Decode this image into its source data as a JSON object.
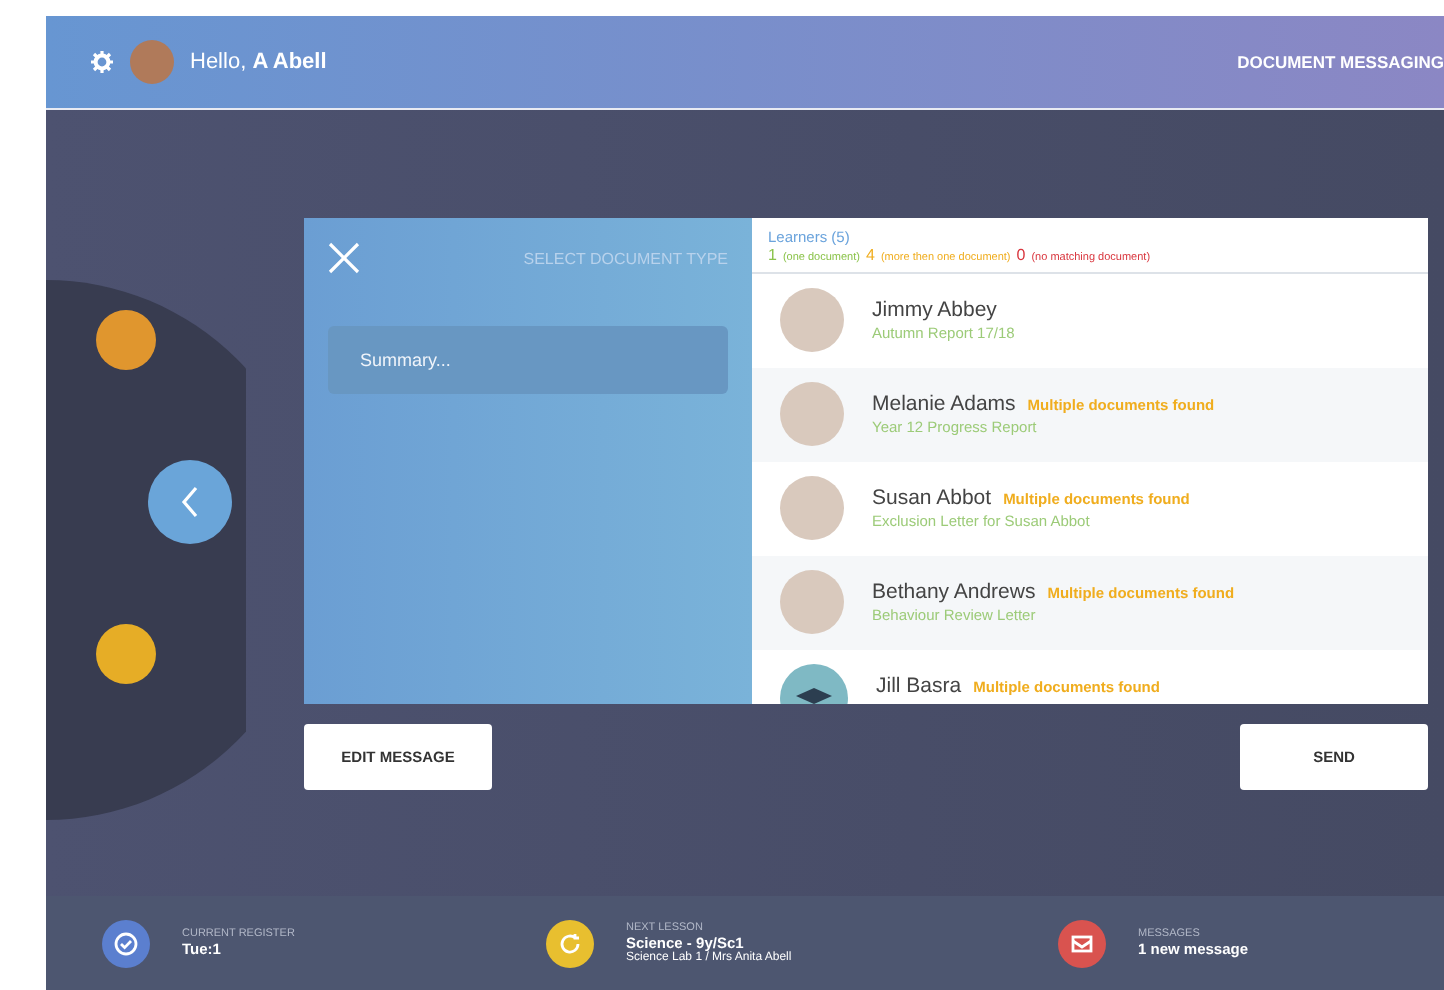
{
  "header": {
    "greeting": "Hello,",
    "user": "A Abell",
    "title": "DOCUMENT MESSAGING"
  },
  "panel": {
    "title": "SELECT DOCUMENT TYPE",
    "summary_placeholder": "Summary..."
  },
  "learners": {
    "heading": "Learners (5)",
    "counts": [
      {
        "number": "1",
        "label": "(one document)",
        "color": "#8bc34a"
      },
      {
        "number": "4",
        "label": "(more then one document)",
        "color": "#f0ad1e"
      },
      {
        "number": "0",
        "label": "(no matching document)",
        "color": "#d9363e"
      }
    ],
    "items": [
      {
        "name": "Jimmy Abbey",
        "kind": "photo",
        "document": "Autumn Report 17/18"
      },
      {
        "name": "Melanie Adams",
        "kind": "photo",
        "status": "Multiple documents found",
        "document": "Year 12 Progress Report"
      },
      {
        "name": "Susan Abbot",
        "kind": "photo",
        "status": "Multiple documents found",
        "document": "Exclusion Letter for Susan Abbot"
      },
      {
        "name": "Bethany Andrews",
        "kind": "photo",
        "status": "Multiple documents found",
        "document": "Behaviour Review Letter"
      },
      {
        "name": "Jill Basra",
        "kind": "default",
        "status": "Multiple documents found"
      }
    ]
  },
  "buttons": [
    "EDIT MESSAGE",
    "SEND"
  ],
  "footer": [
    {
      "kind": "register",
      "color": "#5b7fcf",
      "label": "CURRENT REGISTER",
      "title": "Tue:1"
    },
    {
      "kind": "lesson",
      "color": "#e8bf2f",
      "label": "NEXT LESSON",
      "title": "Science - 9y/Sc1",
      "subtitle": "Science Lab 1 / Mrs Anita Abell"
    },
    {
      "kind": "messages",
      "color": "#d9534f",
      "label": "MESSAGES",
      "title": "1 new message"
    }
  ]
}
